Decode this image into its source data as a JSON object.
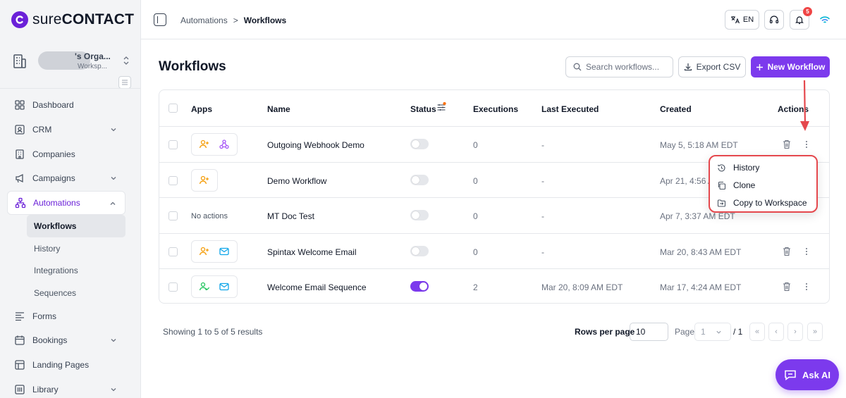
{
  "brand": {
    "name_bold": "sure",
    "name_caps": "CONTACT"
  },
  "org": {
    "name": "'s Orga...",
    "sub": "Worksp..."
  },
  "sidebar": {
    "items": [
      {
        "label": "Dashboard",
        "icon": "dashboard-icon"
      },
      {
        "label": "CRM",
        "icon": "contact-card-icon",
        "chevron": "down"
      },
      {
        "label": "Companies",
        "icon": "building-icon"
      },
      {
        "label": "Campaigns",
        "icon": "megaphone-icon",
        "chevron": "down"
      },
      {
        "label": "Automations",
        "icon": "automation-icon",
        "chevron": "up",
        "active": true
      },
      {
        "label": "Forms",
        "icon": "forms-icon"
      },
      {
        "label": "Bookings",
        "icon": "calendar-icon",
        "chevron": "down"
      },
      {
        "label": "Landing Pages",
        "icon": "landing-page-icon"
      },
      {
        "label": "Library",
        "icon": "library-icon",
        "chevron": "down"
      }
    ],
    "sub_items": [
      {
        "label": "Workflows",
        "active": true
      },
      {
        "label": "History"
      },
      {
        "label": "Integrations"
      },
      {
        "label": "Sequences"
      }
    ]
  },
  "topbar": {
    "breadcrumb": {
      "parent": "Automations",
      "separator": ">",
      "current": "Workflows"
    },
    "language": "EN",
    "notification_count": "5"
  },
  "main": {
    "title": "Workflows",
    "search_placeholder": "Search workflows...",
    "export_label": "Export CSV",
    "new_label": "New Workflow",
    "columns": [
      "Apps",
      "Name",
      "Status",
      "Executions",
      "Last Executed",
      "Created",
      "Actions"
    ],
    "rows": [
      {
        "apps": [
          "user-add-icon",
          "webhook-icon"
        ],
        "name": "Outgoing Webhook Demo",
        "status": "off",
        "executions": "0",
        "last_executed": "-",
        "created": "May 5, 5:18 AM EDT"
      },
      {
        "apps": [
          "user-add-icon"
        ],
        "name": "Demo Workflow",
        "status": "off",
        "executions": "0",
        "last_executed": "-",
        "created": "Apr 21, 4:56 A"
      },
      {
        "apps": [],
        "no_actions": "No actions",
        "name": "MT Doc Test",
        "status": "off",
        "executions": "0",
        "last_executed": "-",
        "created": "Apr 7, 3:37 AM EDT"
      },
      {
        "apps": [
          "user-add-icon",
          "mail-icon"
        ],
        "name": "Spintax Welcome Email",
        "status": "off",
        "executions": "0",
        "last_executed": "-",
        "created": "Mar 20, 8:43 AM EDT"
      },
      {
        "apps": [
          "user-check-icon",
          "mail-icon"
        ],
        "name": "Welcome Email Sequence",
        "status": "on",
        "executions": "2",
        "last_executed": "Mar 20, 8:09 AM EDT",
        "created": "Mar 17, 4:24 AM EDT"
      }
    ],
    "menu": [
      "History",
      "Clone",
      "Copy to Workspace"
    ]
  },
  "footer": {
    "showing": "Showing 1 to 5 of 5 results",
    "rows_per_page_label": "Rows per page",
    "rows_per_page": "10",
    "page_label": "Page",
    "page": "1",
    "of": "/ 1",
    "nav": [
      "«",
      "‹",
      "›",
      "»"
    ]
  },
  "ask_ai": "Ask AI",
  "colors": {
    "brand": "#7c3aed",
    "annotation": "#e5484d",
    "status_on": "#7c3aed"
  }
}
